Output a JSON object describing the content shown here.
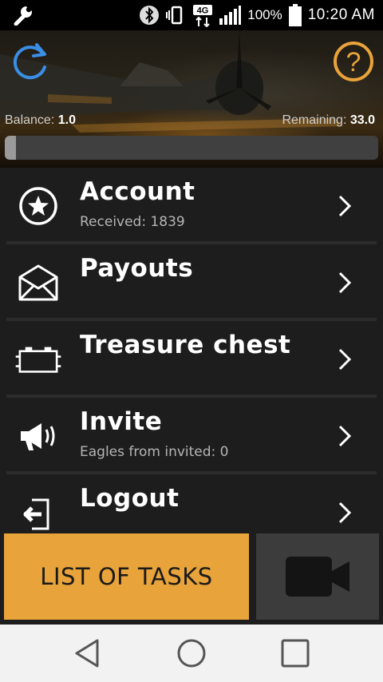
{
  "status_bar": {
    "battery_text": "100%",
    "time": "10:20 AM",
    "network_label": "4G"
  },
  "header": {
    "balance_label": "Balance:",
    "balance_value": "1.0",
    "remaining_label": "Remaining:",
    "remaining_value": "33.0",
    "progress_fraction": 0.03,
    "help_symbol": "?"
  },
  "menu": {
    "items": [
      {
        "title": "Account",
        "subtitle": "Received: 1839",
        "icon": "star-circle-icon"
      },
      {
        "title": "Payouts",
        "subtitle": "",
        "icon": "envelope-icon"
      },
      {
        "title": "Treasure chest",
        "subtitle": "",
        "icon": "chest-icon"
      },
      {
        "title": "Invite",
        "subtitle": "Eagles from invited: 0",
        "icon": "megaphone-icon"
      },
      {
        "title": "Logout",
        "subtitle": "",
        "icon": "logout-icon"
      }
    ]
  },
  "actions": {
    "tasks_label": "LIST OF TASKS",
    "video_icon": "video-camera-icon"
  },
  "colors": {
    "accent_orange": "#e8a33a",
    "refresh_blue": "#3a8ee6",
    "background": "#1d1d1d"
  }
}
